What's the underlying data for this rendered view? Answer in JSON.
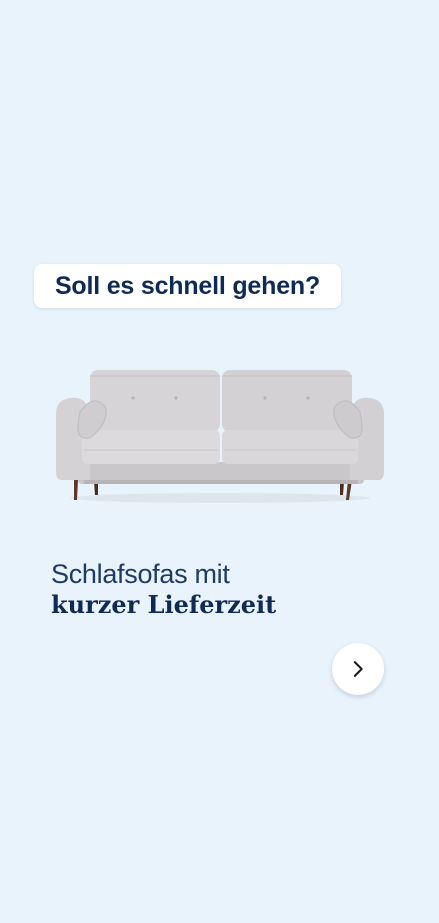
{
  "banner": {
    "headline": "Soll es schnell gehen?",
    "copy_line1": "Schlafsofas mit",
    "copy_line2": "kurzer Lieferzeit",
    "image": "sofa-product-image",
    "next_icon": "chevron-right-icon"
  },
  "colors": {
    "background": "#e9f3fb",
    "headline_text": "#0f2a56",
    "copy_text": "#1f3a66",
    "badge_background": "#ffffff"
  }
}
